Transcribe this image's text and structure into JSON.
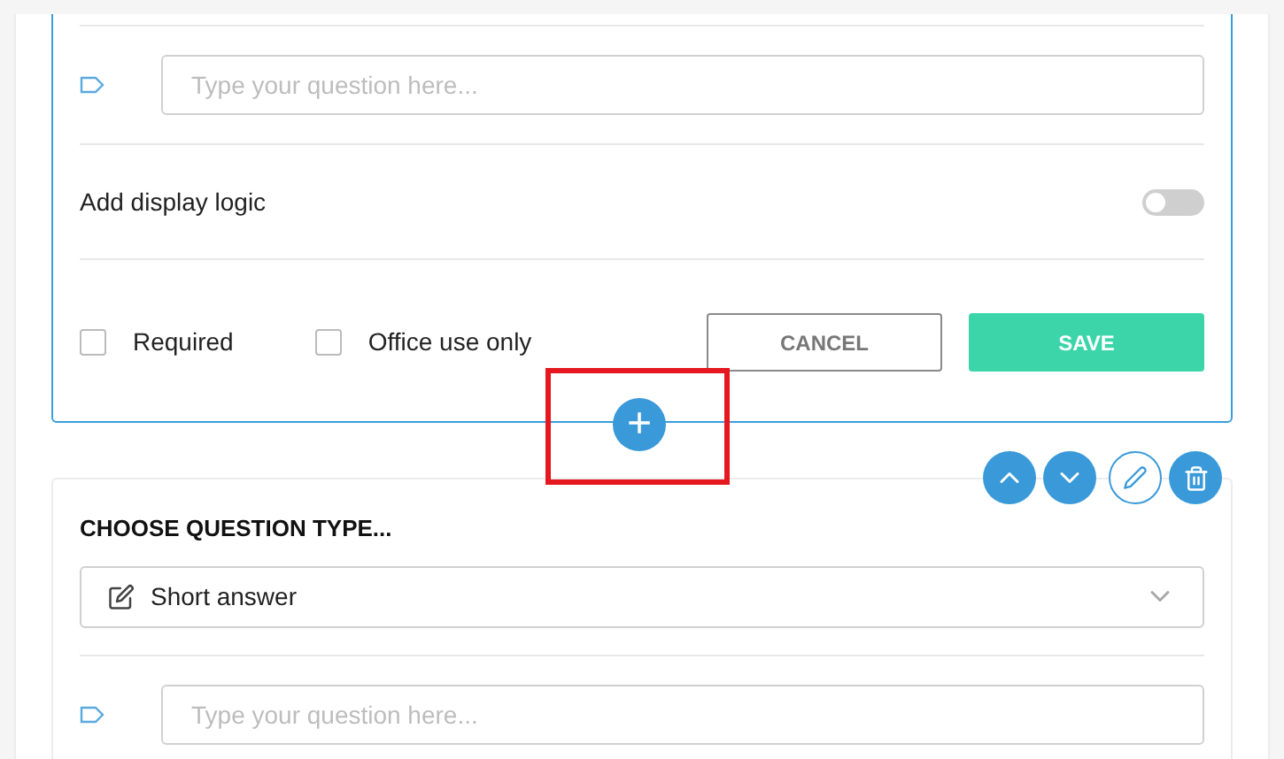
{
  "editing_card": {
    "question_field": {
      "placeholder": "Type your question here..."
    },
    "display_logic": {
      "label": "Add display logic",
      "on": false
    },
    "options": [
      {
        "label": "Required",
        "checked": false
      },
      {
        "label": "Office use only",
        "checked": false
      }
    ],
    "buttons": {
      "cancel": "CANCEL",
      "save": "SAVE"
    }
  },
  "add_button": {
    "symbol": "+",
    "highlighted": true
  },
  "question_card": {
    "heading": "CHOOSE QUESTION TYPE...",
    "question_type": "Short answer",
    "question_field": {
      "placeholder": "Type your question here..."
    }
  }
}
